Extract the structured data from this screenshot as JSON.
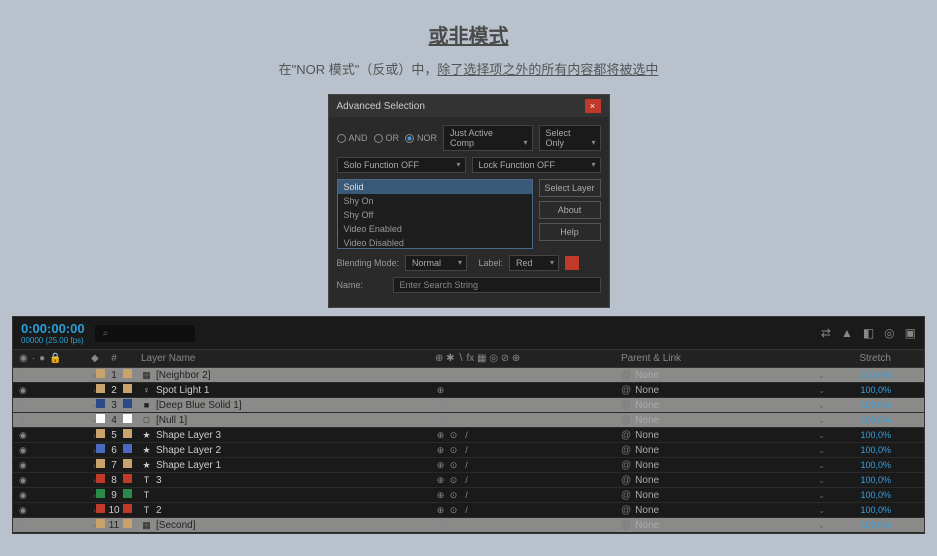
{
  "header": {
    "title": "或非模式",
    "desc_pre": "在\"NOR 模式\"（反或）中，",
    "desc_ul": "除了选择项之外的所有内容都将被选中"
  },
  "dialog": {
    "title": "Advanced Selection",
    "radios": {
      "and": "AND",
      "or": "OR",
      "nor": "NOR"
    },
    "comp_scope": "Just Active Comp",
    "select_mode": "Select Only",
    "solo_fn": "Solo Function OFF",
    "lock_fn": "Lock Function OFF",
    "list": [
      "Solid",
      "Shy On",
      "Shy Off",
      "Video Enabled",
      "Video Disabled"
    ],
    "btn_select": "Select Layer",
    "btn_about": "About",
    "btn_help": "Help",
    "blend_label": "Blending Mode:",
    "blend_val": "Normal",
    "label_label": "Label:",
    "label_val": "Red",
    "name_label": "Name:",
    "name_ph": "Enter Search String"
  },
  "timeline": {
    "timecode": "0:00:00:00",
    "timecode_sub": "00000 (25.00 fps)",
    "search_ph": "⌕",
    "head": {
      "num": "#",
      "layer": "Layer Name",
      "parent": "Parent & Link",
      "stretch": "Stretch"
    },
    "layers": [
      {
        "n": 1,
        "col": "#c9a36b",
        "ico": "▦",
        "name": "[Neighbor 2]",
        "hl": true,
        "sw": [
          "⊕",
          "",
          "/"
        ],
        "parent": "None",
        "stretch": "100,0%"
      },
      {
        "n": 2,
        "col": "#c9a36b",
        "ico": "♀",
        "name": "Spot Light 1",
        "hl": false,
        "sw": [
          "⊕"
        ],
        "parent": "None",
        "stretch": "100,0%"
      },
      {
        "n": 3,
        "col": "#2a4a8a",
        "ico": "■",
        "name": "[Deep Blue Solid 1]",
        "hl": true,
        "sw": [
          "⊕",
          "",
          "/"
        ],
        "parent": "None",
        "stretch": "100,0%"
      },
      {
        "n": 4,
        "col": "#ffffff",
        "ico": "□",
        "name": "[Null 1]",
        "hl": true,
        "sw": [
          "⊕",
          "",
          "/"
        ],
        "parent": "None",
        "stretch": "100,0%"
      },
      {
        "n": 5,
        "col": "#c9a36b",
        "ico": "★",
        "name": "Shape Layer 3",
        "hl": false,
        "sw": [
          "⊕",
          "⊙",
          "/"
        ],
        "parent": "None",
        "stretch": "100,0%"
      },
      {
        "n": 6,
        "col": "#4a6ac0",
        "ico": "★",
        "name": "Shape Layer 2",
        "hl": false,
        "sw": [
          "⊕",
          "⊙",
          "/"
        ],
        "parent": "None",
        "stretch": "100,0%"
      },
      {
        "n": 7,
        "col": "#c9a36b",
        "ico": "★",
        "name": "Shape Layer 1",
        "hl": false,
        "sw": [
          "⊕",
          "⊙",
          "/"
        ],
        "parent": "None",
        "stretch": "100,0%"
      },
      {
        "n": 8,
        "col": "#c0392b",
        "ico": "T",
        "name": "<empty text layer> 3",
        "hl": false,
        "sw": [
          "⊕",
          "⊙",
          "/"
        ],
        "parent": "None",
        "stretch": "100,0%"
      },
      {
        "n": 9,
        "col": "#2a8a4a",
        "ico": "T",
        "name": "<empty text layer>",
        "hl": false,
        "sw": [
          "⊕",
          "⊙",
          "/"
        ],
        "parent": "None",
        "stretch": "100,0%"
      },
      {
        "n": 10,
        "col": "#c0392b",
        "ico": "T",
        "name": "<empty text layer> 2",
        "hl": false,
        "sw": [
          "⊕",
          "⊙",
          "/"
        ],
        "parent": "None",
        "stretch": "100,0%"
      },
      {
        "n": 11,
        "col": "#c9a36b",
        "ico": "▦",
        "name": "[Second]",
        "hl": true,
        "sw": [
          "⊕",
          "",
          "/"
        ],
        "parent": "None",
        "stretch": "100,0%"
      }
    ]
  }
}
